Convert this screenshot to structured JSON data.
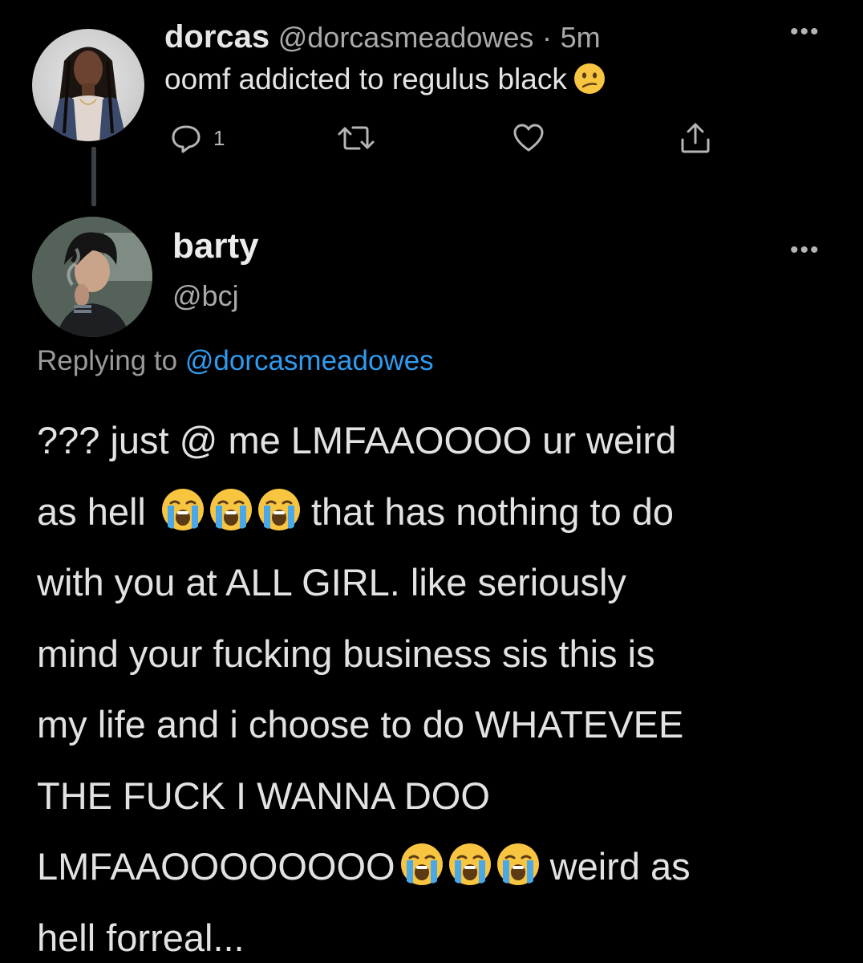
{
  "colors": {
    "background": "#000000",
    "text": "#e2e2e2",
    "secondary_text": "#a9a9a9",
    "link": "#2f9bf0",
    "emoji_yellow": "#f7c53f",
    "tear_blue": "#4aa8e8"
  },
  "tweet1": {
    "name": "dorcas",
    "handle": "@dorcasmeadowes",
    "separator": "·",
    "time": "5m",
    "text": "oomf addicted to regulus black",
    "text_emoji": "confused-face-emoji",
    "reply_count": "1",
    "more_icon": "more-options-icon"
  },
  "tweet2": {
    "name": "barty",
    "handle": "@bcj",
    "replying_prefix": "Replying to",
    "replying_to": "@dorcasmeadowes",
    "more_icon": "more-options-icon",
    "body_lines": {
      "l1": "??? just @ me LMFAAOOOO ur weird",
      "l2a": "as hell",
      "l2b": "that has nothing to do",
      "l3": "with you at ALL GIRL. like seriously",
      "l4": "mind your fucking business sis this is",
      "l5": "my life and i choose to do WHATEVEE",
      "l6": "THE FUCK I WANNA DOO",
      "l7a": "LMFAAOOOOOOOO",
      "l7b": "weird as",
      "l8": "hell forreal..."
    },
    "body_emoji": "loudly-crying-face-emoji"
  }
}
